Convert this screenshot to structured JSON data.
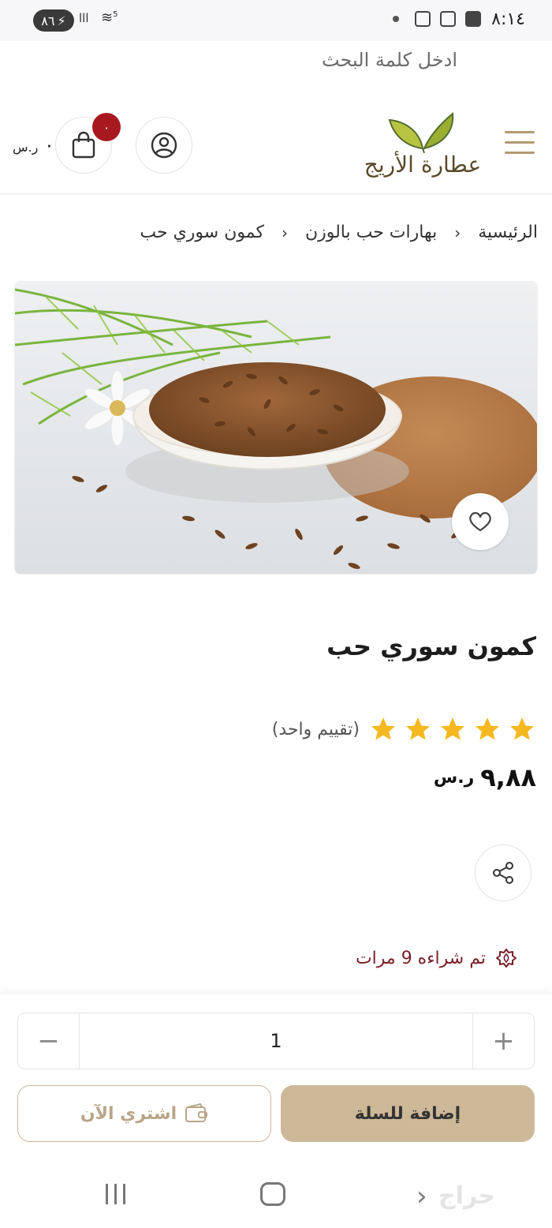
{
  "status_bar": {
    "battery": "٨٦",
    "time": "٨:١٤",
    "signal": "lll",
    "wifi_badge": "5"
  },
  "search": {
    "placeholder": "ادخل كلمة البحث"
  },
  "header": {
    "logo_text": "عطارة الأريج",
    "cart_count": "٠",
    "cart_total": "٠",
    "currency_symbol": "ر.س"
  },
  "breadcrumb": {
    "home": "الرئيسية",
    "category": "بهارات حب بالوزن",
    "current": "كمون سوري حب"
  },
  "product": {
    "title": "كمون سوري حب",
    "rating_stars": 5,
    "rating_text": "(تقييم واحد)",
    "price": "٩,٨٨",
    "sold_text": "تم شراءه 9 مرات",
    "quantity": "1"
  },
  "actions": {
    "add_to_cart": "إضافة للسلة",
    "buy_now": "اشتري الآن"
  },
  "colors": {
    "accent": "#cdb898",
    "badge": "#a8191f",
    "sold": "#7a1f28",
    "star": "#f5b820"
  },
  "watermark": "حراج"
}
